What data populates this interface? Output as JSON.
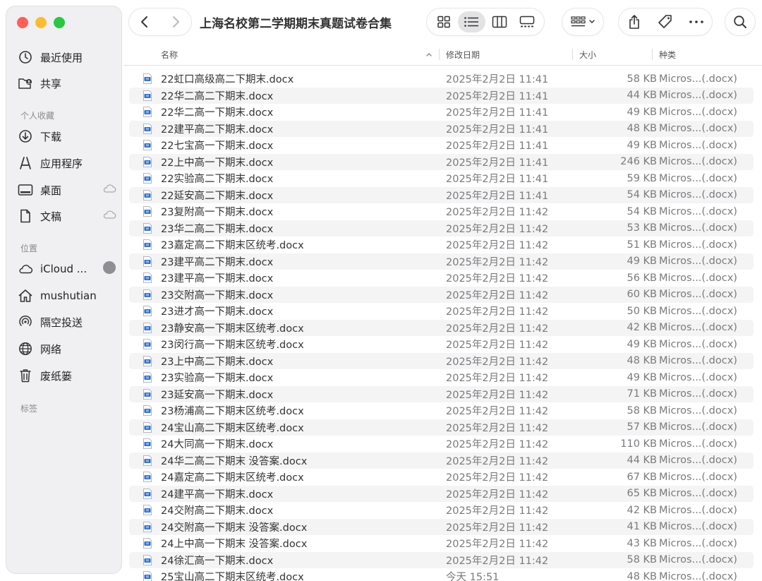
{
  "window": {
    "title": "上海名校第二学期期末真题试卷合集"
  },
  "sidebar": {
    "top_items": [
      {
        "label": "最近使用",
        "icon": "clock-icon"
      },
      {
        "label": "共享",
        "icon": "shared-folder-icon"
      }
    ],
    "favorites_heading": "个人收藏",
    "favorites": [
      {
        "label": "下载",
        "icon": "download-icon"
      },
      {
        "label": "应用程序",
        "icon": "applications-icon"
      },
      {
        "label": "桌面",
        "icon": "desktop-icon",
        "cloud": true
      },
      {
        "label": "文稿",
        "icon": "document-icon",
        "cloud": true
      }
    ],
    "locations_heading": "位置",
    "locations": [
      {
        "label": "iCloud ...",
        "icon": "icloud-icon",
        "progress": true
      },
      {
        "label": "mushutian",
        "icon": "home-icon"
      },
      {
        "label": "隔空投送",
        "icon": "airdrop-icon"
      },
      {
        "label": "网络",
        "icon": "network-icon"
      },
      {
        "label": "废纸篓",
        "icon": "trash-icon"
      }
    ],
    "tags_heading": "标签"
  },
  "columns": {
    "name": "名称",
    "date": "修改日期",
    "size": "大小",
    "kind": "种类"
  },
  "files": [
    {
      "name": "22虹口高级高二下期末.docx",
      "date": "2025年2月2日 11:41",
      "size": "58 KB",
      "kind": "Micros...(.docx)"
    },
    {
      "name": "22华二高二下期末.docx",
      "date": "2025年2月2日 11:41",
      "size": "44 KB",
      "kind": "Micros...(.docx)"
    },
    {
      "name": "22华二高一下期末.docx",
      "date": "2025年2月2日 11:41",
      "size": "49 KB",
      "kind": "Micros...(.docx)"
    },
    {
      "name": "22建平高二下期末.docx",
      "date": "2025年2月2日 11:41",
      "size": "48 KB",
      "kind": "Micros...(.docx)"
    },
    {
      "name": "22七宝高一下期末.docx",
      "date": "2025年2月2日 11:41",
      "size": "49 KB",
      "kind": "Micros...(.docx)"
    },
    {
      "name": "22上中高一下期末.docx",
      "date": "2025年2月2日 11:41",
      "size": "246 KB",
      "kind": "Micros...(.docx)"
    },
    {
      "name": "22实验高二下期末.docx",
      "date": "2025年2月2日 11:41",
      "size": "59 KB",
      "kind": "Micros...(.docx)"
    },
    {
      "name": "22延安高二下期末.docx",
      "date": "2025年2月2日 11:41",
      "size": "54 KB",
      "kind": "Micros...(.docx)"
    },
    {
      "name": "23复附高一下期末.docx",
      "date": "2025年2月2日 11:42",
      "size": "54 KB",
      "kind": "Micros...(.docx)"
    },
    {
      "name": "23华二高二下期末.docx",
      "date": "2025年2月2日 11:42",
      "size": "53 KB",
      "kind": "Micros...(.docx)"
    },
    {
      "name": "23嘉定高二下期末区统考.docx",
      "date": "2025年2月2日 11:42",
      "size": "51 KB",
      "kind": "Micros...(.docx)"
    },
    {
      "name": "23建平高二下期末.docx",
      "date": "2025年2月2日 11:42",
      "size": "49 KB",
      "kind": "Micros...(.docx)"
    },
    {
      "name": "23建平高一下期末.docx",
      "date": "2025年2月2日 11:42",
      "size": "56 KB",
      "kind": "Micros...(.docx)"
    },
    {
      "name": "23交附高一下期末.docx",
      "date": "2025年2月2日 11:42",
      "size": "60 KB",
      "kind": "Micros...(.docx)"
    },
    {
      "name": "23进才高一下期末.docx",
      "date": "2025年2月2日 11:42",
      "size": "50 KB",
      "kind": "Micros...(.docx)"
    },
    {
      "name": "23静安高一下期末区统考.docx",
      "date": "2025年2月2日 11:42",
      "size": "42 KB",
      "kind": "Micros...(.docx)"
    },
    {
      "name": "23闵行高一下期末区统考.docx",
      "date": "2025年2月2日 11:42",
      "size": "49 KB",
      "kind": "Micros...(.docx)"
    },
    {
      "name": "23上中高二下期末.docx",
      "date": "2025年2月2日 11:42",
      "size": "48 KB",
      "kind": "Micros...(.docx)"
    },
    {
      "name": "23实验高一下期末.docx",
      "date": "2025年2月2日 11:42",
      "size": "49 KB",
      "kind": "Micros...(.docx)"
    },
    {
      "name": "23延安高一下期末.docx",
      "date": "2025年2月2日 11:42",
      "size": "71 KB",
      "kind": "Micros...(.docx)"
    },
    {
      "name": "23杨浦高二下期末区统考.docx",
      "date": "2025年2月2日 11:42",
      "size": "58 KB",
      "kind": "Micros...(.docx)"
    },
    {
      "name": "24宝山高二下期末区统考.docx",
      "date": "2025年2月2日 11:42",
      "size": "57 KB",
      "kind": "Micros...(.docx)"
    },
    {
      "name": "24大同高一下期末.docx",
      "date": "2025年2月2日 11:42",
      "size": "110 KB",
      "kind": "Micros...(.docx)"
    },
    {
      "name": "24华二高二下期末 没答案.docx",
      "date": "2025年2月2日 11:42",
      "size": "44 KB",
      "kind": "Micros...(.docx)"
    },
    {
      "name": "24嘉定高二下期末区统考.docx",
      "date": "2025年2月2日 11:42",
      "size": "67 KB",
      "kind": "Micros...(.docx)"
    },
    {
      "name": "24建平高一下期末.docx",
      "date": "2025年2月2日 11:42",
      "size": "65 KB",
      "kind": "Micros...(.docx)"
    },
    {
      "name": "24交附高二下期末.docx",
      "date": "2025年2月2日 11:42",
      "size": "42 KB",
      "kind": "Micros...(.docx)"
    },
    {
      "name": "24交附高一下期末 没答案.docx",
      "date": "2025年2月2日 11:42",
      "size": "41 KB",
      "kind": "Micros...(.docx)"
    },
    {
      "name": "24上中高一下期末 没答案.docx",
      "date": "2025年2月2日 11:42",
      "size": "43 KB",
      "kind": "Micros...(.docx)"
    },
    {
      "name": "24徐汇高一下期末.docx",
      "date": "2025年2月2日 11:42",
      "size": "58 KB",
      "kind": "Micros...(.docx)"
    },
    {
      "name": "25宝山高二下期末区统考.docx",
      "date": "今天 15:51",
      "size": "48 KB",
      "kind": "Micros...(.docx)"
    }
  ]
}
